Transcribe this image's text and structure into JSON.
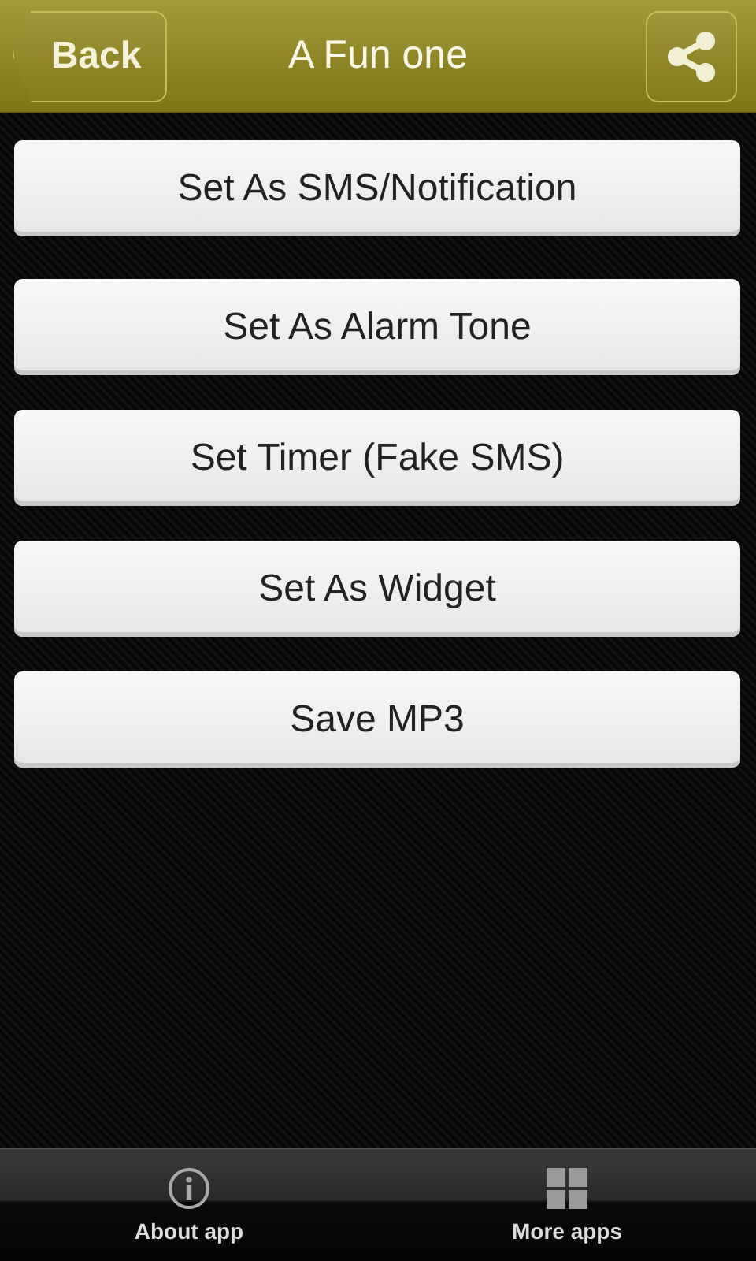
{
  "header": {
    "back": "Back",
    "title": "A Fun one"
  },
  "actions": [
    "Set As SMS/Notification",
    "Set As Alarm Tone",
    "Set Timer (Fake SMS)",
    "Set As Widget",
    "Save MP3"
  ],
  "tab_bar": [
    {
      "label": "About app",
      "kind": "info"
    },
    {
      "label": "More apps",
      "kind": "grid"
    }
  ]
}
